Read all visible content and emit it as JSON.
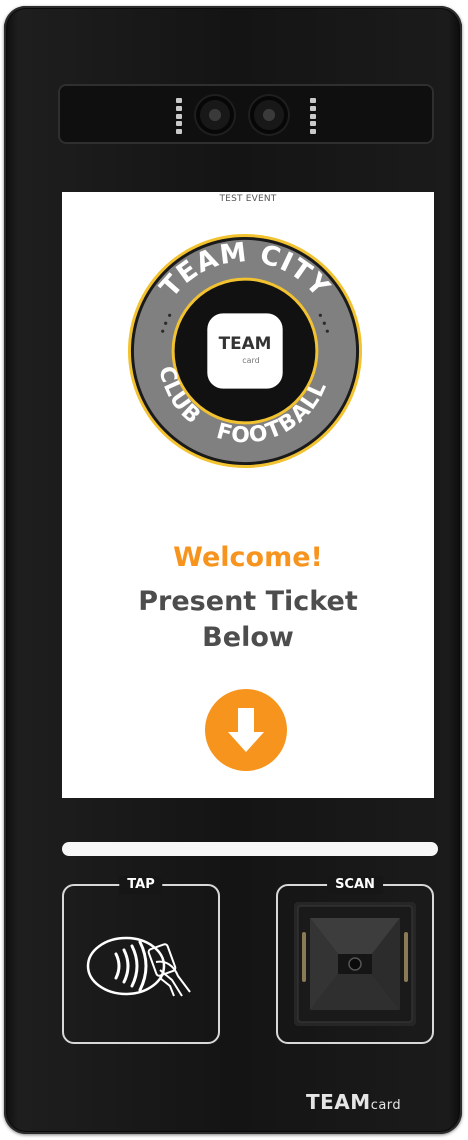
{
  "screen": {
    "event_label": "TEST EVENT",
    "crest": {
      "top_text": "TEAM CITY",
      "right_text": "FOOTBALL",
      "left_text": "CLUB",
      "badge_line1": "TEAM",
      "badge_line2": "card"
    },
    "welcome": "Welcome!",
    "instruction_line1": "Present Ticket",
    "instruction_line2": "Below",
    "arrow_icon": "arrow-down-icon"
  },
  "readers": {
    "tap_label": "TAP",
    "scan_label": "SCAN"
  },
  "brand": {
    "main": "TEAM",
    "small": "card"
  },
  "colors": {
    "accent_orange": "#f7941d",
    "text_dark": "#4d4d4d",
    "crest_ring": "#808080",
    "crest_trim": "#f2c230",
    "device_body": "#141414"
  }
}
